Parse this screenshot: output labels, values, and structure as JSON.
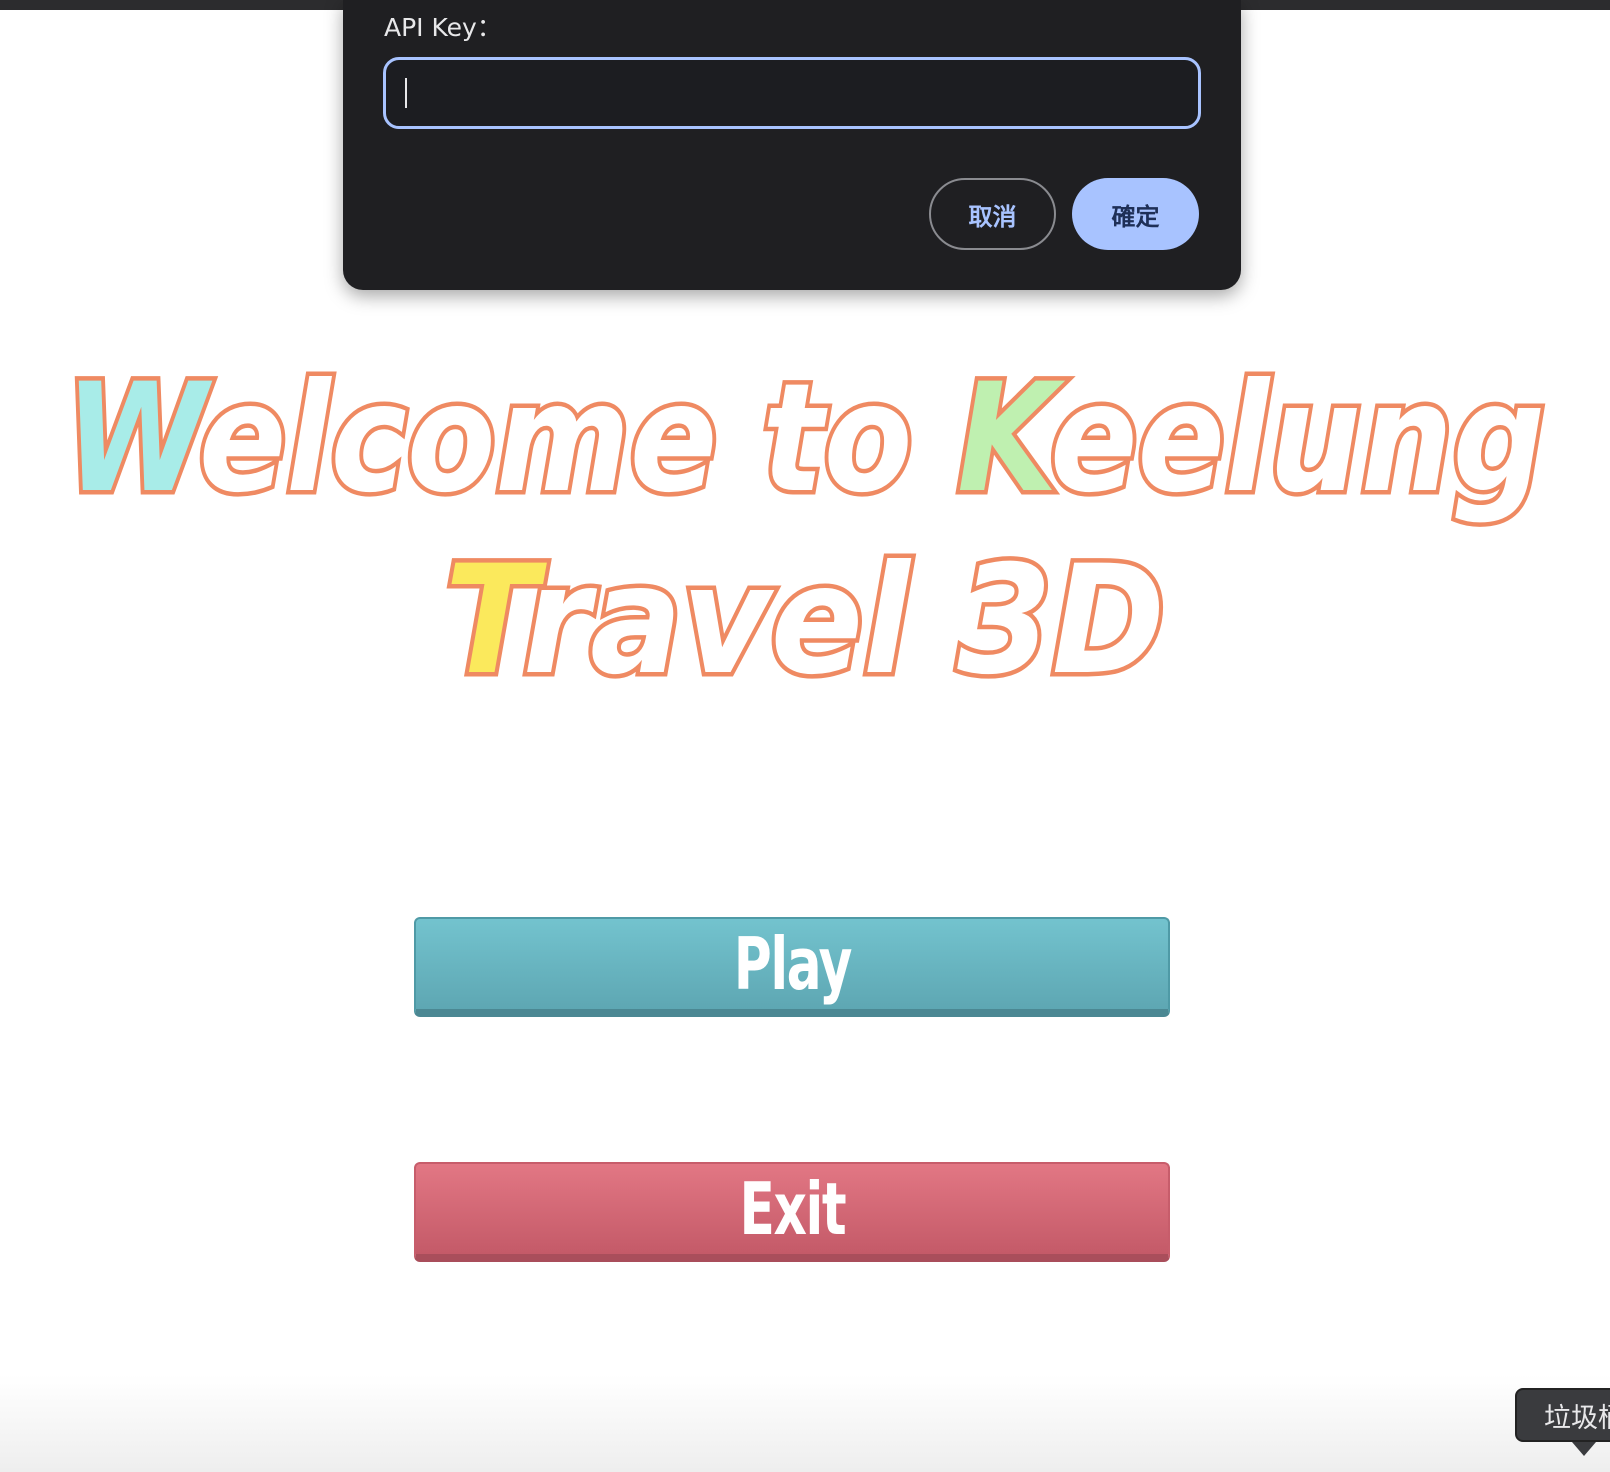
{
  "dialog": {
    "label": "API Key：",
    "input_value": "",
    "cancel_label": "取消",
    "confirm_label": "確定",
    "accent_color": "#a8c3ff",
    "background_color": "#1f1f22"
  },
  "title": {
    "line1_w": "W",
    "line1_rest_a": "elcome to ",
    "line1_k": "K",
    "line1_rest_b": "eelung",
    "line2_t": "T",
    "line2_rest": "ravel 3D",
    "outline_color": "#ef8a62"
  },
  "menu": {
    "play_label": "Play",
    "exit_label": "Exit",
    "play_color": "#6cb7c2",
    "exit_color": "#d56a78"
  },
  "tooltip": {
    "text": "垃圾桶"
  }
}
